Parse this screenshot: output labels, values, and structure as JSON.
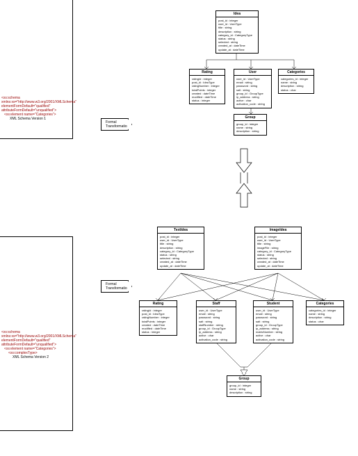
{
  "schemaLabels": {
    "v1": "XML Schema Version 1",
    "v2": "XML Schema Version 2"
  },
  "xml": {
    "schemaOpen": "<xs:schema xmlns:xs=\"http://www.w3.org/2001/XMLSchema\" elementFormDefault=\"qualified\" attributeFormDefault=\"unqualified\">",
    "elem": "<xs:element name=\"Categories\">",
    "complex": "<xs:complexType>"
  },
  "transform": "Formal Transformation",
  "classes": {
    "idea": {
      "title": "Idea",
      "attrs": [
        "post_id : integer",
        "user_id : UserType",
        "title : string",
        "description : string",
        "category_id : CategoryType",
        "status : string",
        "selected : string",
        "created_at : dateTime",
        "update_at : dateTime"
      ]
    },
    "rating": {
      "title": "Rating",
      "attrs": [
        "ratingId : integer",
        "post_id : IdeaType",
        "ratingNumber : integer",
        "totalPoints : integer",
        "created : dateTime",
        "modified : dateTime",
        "status : integer"
      ]
    },
    "user": {
      "title": "User",
      "attrs": [
        "user_id : UserType",
        "email : string",
        "password : string",
        "salt : string",
        "group_id : GroupType",
        "ip_address : string",
        "active : char",
        "activation_code : string"
      ]
    },
    "categories": {
      "title": "Categories",
      "attrs": [
        "categories_id : integer",
        "name : string",
        "description : string",
        "status : char"
      ]
    },
    "group": {
      "title": "Group",
      "attrs": [
        "group_id : integer",
        "name : string",
        "description : string"
      ]
    },
    "textidea": {
      "title": "TextIdea",
      "attrs": [
        "post_id : integer",
        "user_id : UserType",
        "title : string",
        "description : string",
        "category_id : CategoryType",
        "status : string",
        "selected : string",
        "created_at : dateTime",
        "update_at : dateTime"
      ]
    },
    "imageidea": {
      "title": "ImageIdea",
      "attrs": [
        "post_id : integer",
        "user_id : UserType",
        "title : string",
        "imageFile : string",
        "category_id : CategoryType",
        "status : string",
        "selected : string",
        "created_at : dateTime",
        "update_at : dateTime"
      ]
    },
    "staff": {
      "title": "Staff",
      "attrs": [
        "user_id : UserType",
        "email : string",
        "password : string",
        "salt : string",
        "staffNumber : string",
        "group_id : GroupType",
        "ip_address : string",
        "active : char",
        "activation_code : string"
      ]
    },
    "student": {
      "title": "Student",
      "attrs": [
        "user_id : UserType",
        "email : string",
        "password : string",
        "salt : string",
        "group_id : GroupType",
        "ip_address : string",
        "matricNumber : string",
        "active : char",
        "activation_code : string"
      ]
    }
  }
}
